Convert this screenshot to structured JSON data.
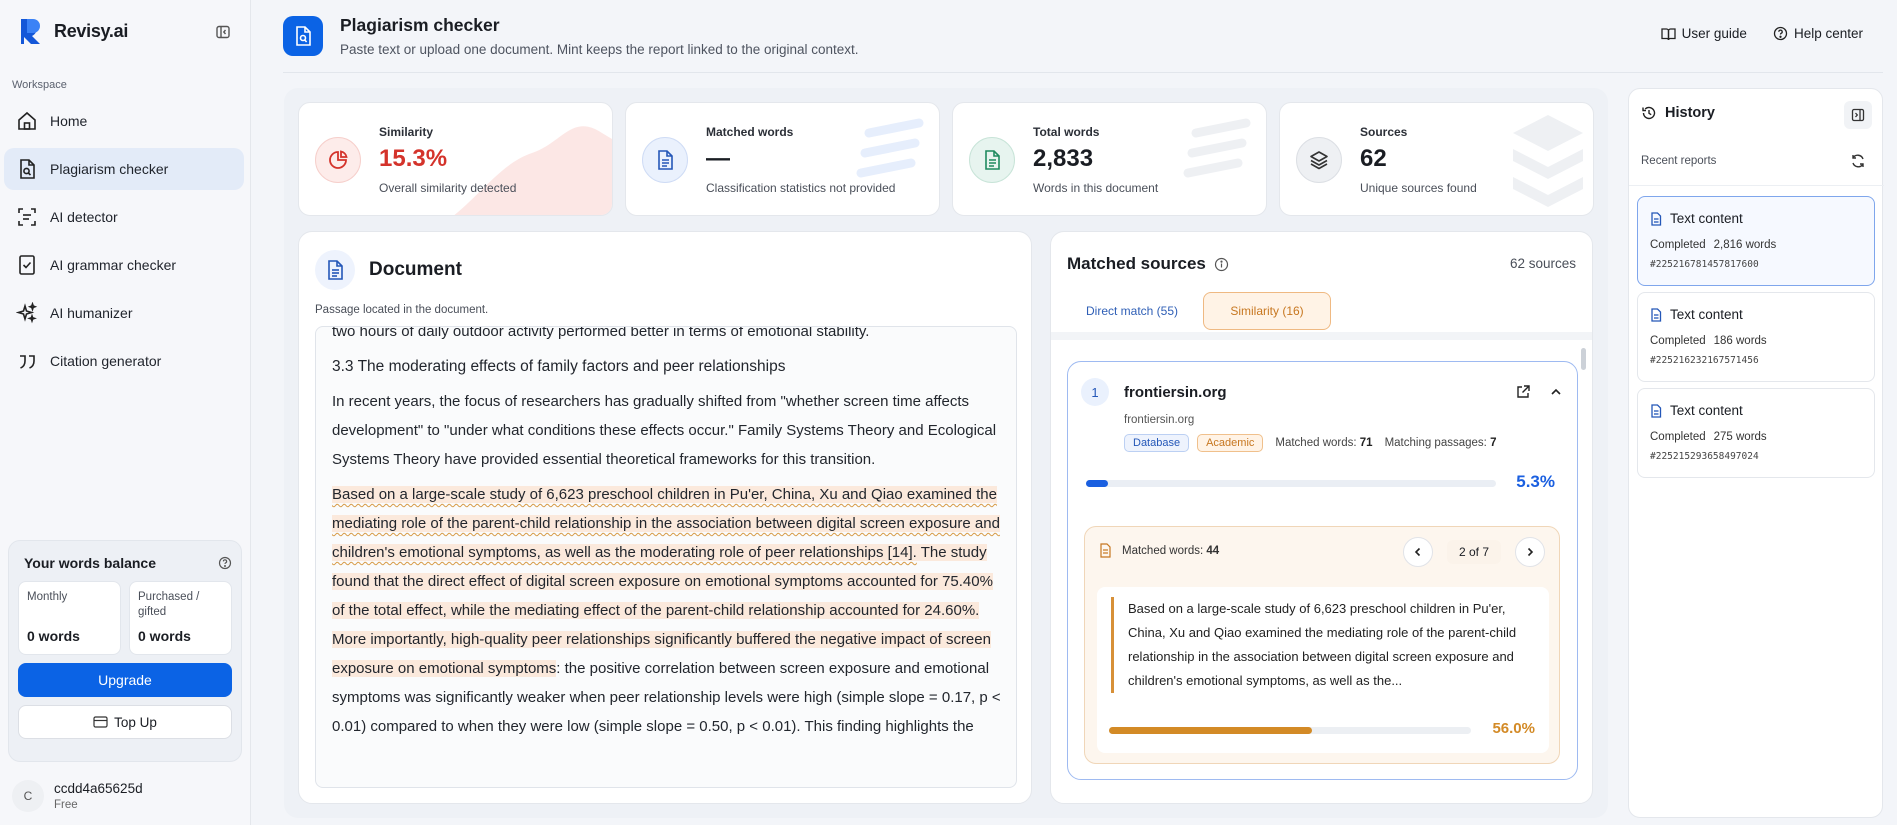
{
  "brand": {
    "name": "Revisy.ai"
  },
  "sidebar": {
    "workspace_label": "Workspace",
    "items": [
      {
        "label": "Home",
        "icon": "home-icon"
      },
      {
        "label": "Plagiarism checker",
        "icon": "doc-search-icon"
      },
      {
        "label": "AI detector",
        "icon": "scan-icon"
      },
      {
        "label": "AI grammar checker",
        "icon": "check-doc-icon"
      },
      {
        "label": "AI humanizer",
        "icon": "sparkle-icon"
      },
      {
        "label": "Citation generator",
        "icon": "quote-icon"
      }
    ],
    "active_index": 1
  },
  "balance": {
    "title": "Your words balance",
    "monthly_label": "Monthly",
    "monthly_value": "0 words",
    "purchased_label": "Purchased / gifted",
    "purchased_value": "0 words",
    "upgrade_label": "Upgrade",
    "topup_label": "Top Up"
  },
  "user": {
    "initial": "C",
    "name": "ccdd4a65625d",
    "plan": "Free"
  },
  "header": {
    "title": "Plagiarism checker",
    "subtitle": "Paste text or upload one document. Mint keeps the report linked to the original context.",
    "user_guide": "User guide",
    "help_center": "Help center"
  },
  "stats": [
    {
      "label": "Similarity",
      "value": "15.3%",
      "desc": "Overall similarity detected",
      "color": "#d4332b"
    },
    {
      "label": "Matched words",
      "value": "—",
      "desc": "Classification statistics not provided",
      "color": "#1a1d23"
    },
    {
      "label": "Total words",
      "value": "2,833",
      "desc": "Words in this document",
      "color": "#1a1d23"
    },
    {
      "label": "Sources",
      "value": "62",
      "desc": "Unique sources found",
      "color": "#1a1d23"
    }
  ],
  "document": {
    "title": "Document",
    "note": "Passage located in the document.",
    "partial_line": "two hours of daily outdoor activity performed better in terms of emotional stability.",
    "heading": "3.3 The moderating effects of family factors and peer relationships",
    "para1": "In recent years, the focus of researchers has gradually shifted from \"whether screen time affects development\" to \"under what conditions these effects occur.\" Family Systems Theory and Ecological Systems Theory have provided essential theoretical frameworks for this transition.",
    "hl1": "Based on a large-scale study of 6,623 preschool children in Pu'er, China, Xu and Qiao examined the mediating role of the parent-child relationship in the association between digital screen exposure and children's emotional symptoms, as well as the moderating role of peer relationships [14].",
    "hl2": " The study found that the direct effect of digital screen exposure on emotional symptoms accounted for 75.40% of the total effect, while the mediating effect of the parent-child relationship accounted for 24.60%. More importantly, high-quality peer relationships significantly buffered the negative impact of screen exposure on emotional symptoms",
    "rest": ": the positive correlation between screen exposure and emotional symptoms was significantly weaker when peer relationship levels were high (simple slope = 0.17, p < 0.01) compared to when they were low (simple slope = 0.50, p < 0.01). This finding highlights the"
  },
  "matched": {
    "title": "Matched sources",
    "count_label": "62 sources",
    "tab_direct": "Direct match (55)",
    "tab_similarity": "Similarity (16)",
    "source": {
      "index": "1",
      "domain": "frontiersin.org",
      "url": "frontiersin.org",
      "tag1": "Database",
      "tag2": "Academic",
      "matched_words_label": "Matched words:",
      "matched_words": "71",
      "passages_label": "Matching passages:",
      "passages": "7",
      "percent": "5.3%",
      "percent_value": 5.3
    },
    "passage": {
      "matched_label": "Matched words:",
      "matched_value": "44",
      "pager": "2 of 7",
      "text": "Based on a large-scale study of 6,623 preschool children in Pu'er, China, Xu and Qiao examined the mediating role of the parent-child relationship in the association between digital screen exposure and children's emotional symptoms, as well as the...",
      "percent": "56.0%",
      "percent_value": 56.0
    }
  },
  "history": {
    "title": "History",
    "recent_label": "Recent reports",
    "items": [
      {
        "title": "Text content",
        "status": "Completed",
        "words": "2,816 words",
        "id": "#225216781457817600"
      },
      {
        "title": "Text content",
        "status": "Completed",
        "words": "186 words",
        "id": "#225216232167571456"
      },
      {
        "title": "Text content",
        "status": "Completed",
        "words": "275 words",
        "id": "#225215293658497024"
      }
    ]
  }
}
